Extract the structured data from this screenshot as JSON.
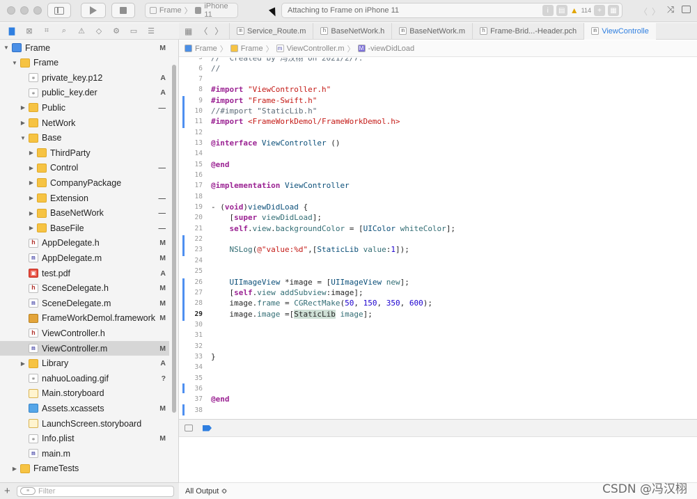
{
  "toolbar": {
    "scheme": "Frame",
    "device": "iPhone 11",
    "status": "Attaching to Frame on iPhone 11",
    "warning_count": "114"
  },
  "sidebar": {
    "rows": [
      {
        "label": "Frame",
        "icon": "proj",
        "level": 0,
        "disc": "▼",
        "badge": "M"
      },
      {
        "label": "Frame",
        "icon": "folder",
        "level": 1,
        "disc": "▼",
        "badge": ""
      },
      {
        "label": "private_key.p12",
        "icon": "gen",
        "level": 2,
        "disc": "",
        "badge": "A"
      },
      {
        "label": "public_key.der",
        "icon": "gen",
        "level": 2,
        "disc": "",
        "badge": "A"
      },
      {
        "label": "Public",
        "icon": "folder",
        "level": 2,
        "disc": "▶",
        "badge": "—"
      },
      {
        "label": "NetWork",
        "icon": "folder",
        "level": 2,
        "disc": "▶",
        "badge": ""
      },
      {
        "label": "Base",
        "icon": "folder",
        "level": 2,
        "disc": "▼",
        "badge": ""
      },
      {
        "label": "ThirdParty",
        "icon": "folder",
        "level": 3,
        "disc": "▶",
        "badge": ""
      },
      {
        "label": "Control",
        "icon": "folder",
        "level": 3,
        "disc": "▶",
        "badge": "—"
      },
      {
        "label": "CompanyPackage",
        "icon": "folder",
        "level": 3,
        "disc": "▶",
        "badge": ""
      },
      {
        "label": "Extension",
        "icon": "folder",
        "level": 3,
        "disc": "▶",
        "badge": "—"
      },
      {
        "label": "BaseNetWork",
        "icon": "folder",
        "level": 3,
        "disc": "▶",
        "badge": "—"
      },
      {
        "label": "BaseFile",
        "icon": "folder",
        "level": 3,
        "disc": "▶",
        "badge": "—"
      },
      {
        "label": "AppDelegate.h",
        "icon": "hfile",
        "level": 2,
        "disc": "",
        "badge": "M"
      },
      {
        "label": "AppDelegate.m",
        "icon": "mfile",
        "level": 2,
        "disc": "",
        "badge": "M"
      },
      {
        "label": "test.pdf",
        "icon": "pdf",
        "level": 2,
        "disc": "",
        "badge": "A"
      },
      {
        "label": "SceneDelegate.h",
        "icon": "hfile",
        "level": 2,
        "disc": "",
        "badge": "M"
      },
      {
        "label": "SceneDelegate.m",
        "icon": "mfile",
        "level": 2,
        "disc": "",
        "badge": "M"
      },
      {
        "label": "FrameWorkDemol.framework",
        "icon": "fw",
        "level": 2,
        "disc": "",
        "badge": "M"
      },
      {
        "label": "ViewController.h",
        "icon": "hfile",
        "level": 2,
        "disc": "",
        "badge": ""
      },
      {
        "label": "ViewController.m",
        "icon": "mfile",
        "level": 2,
        "disc": "",
        "badge": "M",
        "selected": true
      },
      {
        "label": "Library",
        "icon": "folder",
        "level": 2,
        "disc": "▶",
        "badge": "A"
      },
      {
        "label": "nahuoLoading.gif",
        "icon": "gen",
        "level": 2,
        "disc": "",
        "badge": "?"
      },
      {
        "label": "Main.storyboard",
        "icon": "sb",
        "level": 2,
        "disc": "",
        "badge": ""
      },
      {
        "label": "Assets.xcassets",
        "icon": "assets",
        "level": 2,
        "disc": "",
        "badge": "M"
      },
      {
        "label": "LaunchScreen.storyboard",
        "icon": "sb",
        "level": 2,
        "disc": "",
        "badge": ""
      },
      {
        "label": "Info.plist",
        "icon": "gen",
        "level": 2,
        "disc": "",
        "badge": "M"
      },
      {
        "label": "main.m",
        "icon": "mfile",
        "level": 2,
        "disc": "",
        "badge": ""
      },
      {
        "label": "FrameTests",
        "icon": "folder",
        "level": 1,
        "disc": "▶",
        "badge": ""
      }
    ],
    "filter_placeholder": "Filter"
  },
  "tabs": [
    {
      "label": "Service_Route.m",
      "ico": "m",
      "active": false
    },
    {
      "label": "BaseNetWork.h",
      "ico": "h",
      "active": false
    },
    {
      "label": "BaseNetWork.m",
      "ico": "m",
      "active": false
    },
    {
      "label": "Frame-Brid...-Header.pch",
      "ico": "h",
      "active": false
    },
    {
      "label": "ViewControlle",
      "ico": "m",
      "active": true
    }
  ],
  "jumpbar": {
    "items": [
      "Frame",
      "Frame",
      "ViewController.m",
      "-viewDidLoad"
    ]
  },
  "code": {
    "current_line": 29,
    "lines": [
      {
        "n": 5,
        "html": "<span class='cm'>//  Created by 冯汉栩 on 2021/2/7.</span>"
      },
      {
        "n": 6,
        "html": "<span class='cm'>//</span>"
      },
      {
        "n": 7,
        "html": ""
      },
      {
        "n": 8,
        "html": "<span class='kw'>#import</span> <span class='str'>\"ViewController.h\"</span>"
      },
      {
        "n": 9,
        "html": "<span class='kw'>#import</span> <span class='str'>\"Frame-Swift.h\"</span>"
      },
      {
        "n": 10,
        "html": "<span class='cm'>//#import \"StaticLib.h\"</span>"
      },
      {
        "n": 11,
        "html": "<span class='kw'>#import</span> <span class='str'>&lt;FrameWorkDemol/FrameWorkDemol.h&gt;</span>"
      },
      {
        "n": 12,
        "html": ""
      },
      {
        "n": 13,
        "html": "<span class='kw'>@interface</span> <span class='cls'>ViewController</span> ()"
      },
      {
        "n": 14,
        "html": ""
      },
      {
        "n": 15,
        "html": "<span class='kw'>@end</span>"
      },
      {
        "n": 16,
        "html": ""
      },
      {
        "n": 17,
        "html": "<span class='kw'>@implementation</span> <span class='cls'>ViewController</span>"
      },
      {
        "n": 18,
        "html": ""
      },
      {
        "n": 19,
        "html": "- (<span class='kw'>void</span>)<span class='cls'>viewDidLoad</span> {"
      },
      {
        "n": 20,
        "html": "    [<span class='kw'>super</span> <span class='mth'>viewDidLoad</span>];"
      },
      {
        "n": 21,
        "html": "    <span class='kw'>self</span>.<span class='mth'>view</span>.<span class='mth'>backgroundColor</span> = [<span class='cls'>UIColor</span> <span class='mth'>whiteColor</span>];"
      },
      {
        "n": 22,
        "html": ""
      },
      {
        "n": 23,
        "html": "    <span class='mth'>NSLog</span>(<span class='str'>@\"value:%d\"</span>,[<span class='cls'>StaticLib</span> <span class='mth'>value</span>:<span class='num'>1</span>]);"
      },
      {
        "n": 24,
        "html": ""
      },
      {
        "n": 25,
        "html": ""
      },
      {
        "n": 26,
        "html": "    <span class='cls'>UIImageView</span> *image = [<span class='cls'>UIImageView</span> <span class='mth'>new</span>];"
      },
      {
        "n": 27,
        "html": "    [<span class='kw'>self</span>.<span class='mth'>view</span> <span class='mth'>addSubview</span>:image];"
      },
      {
        "n": 28,
        "html": "    image.<span class='mth'>frame</span> = <span class='mth'>CGRectMake</span>(<span class='num'>50</span>, <span class='num'>150</span>, <span class='num'>350</span>, <span class='num'>600</span>);"
      },
      {
        "n": 29,
        "html": "    image.<span class='mth'>image</span> =[<span class='hl'>StaticLib</span> <span class='mth'>image</span>];"
      },
      {
        "n": 30,
        "html": ""
      },
      {
        "n": 31,
        "html": ""
      },
      {
        "n": 32,
        "html": ""
      },
      {
        "n": 33,
        "html": "}"
      },
      {
        "n": 34,
        "html": ""
      },
      {
        "n": 35,
        "html": ""
      },
      {
        "n": 36,
        "html": ""
      },
      {
        "n": 37,
        "html": "<span class='kw'>@end</span>"
      },
      {
        "n": 38,
        "html": ""
      }
    ]
  },
  "console": {
    "output_label": "All Output ≎"
  },
  "watermark": "CSDN @冯汉栩"
}
